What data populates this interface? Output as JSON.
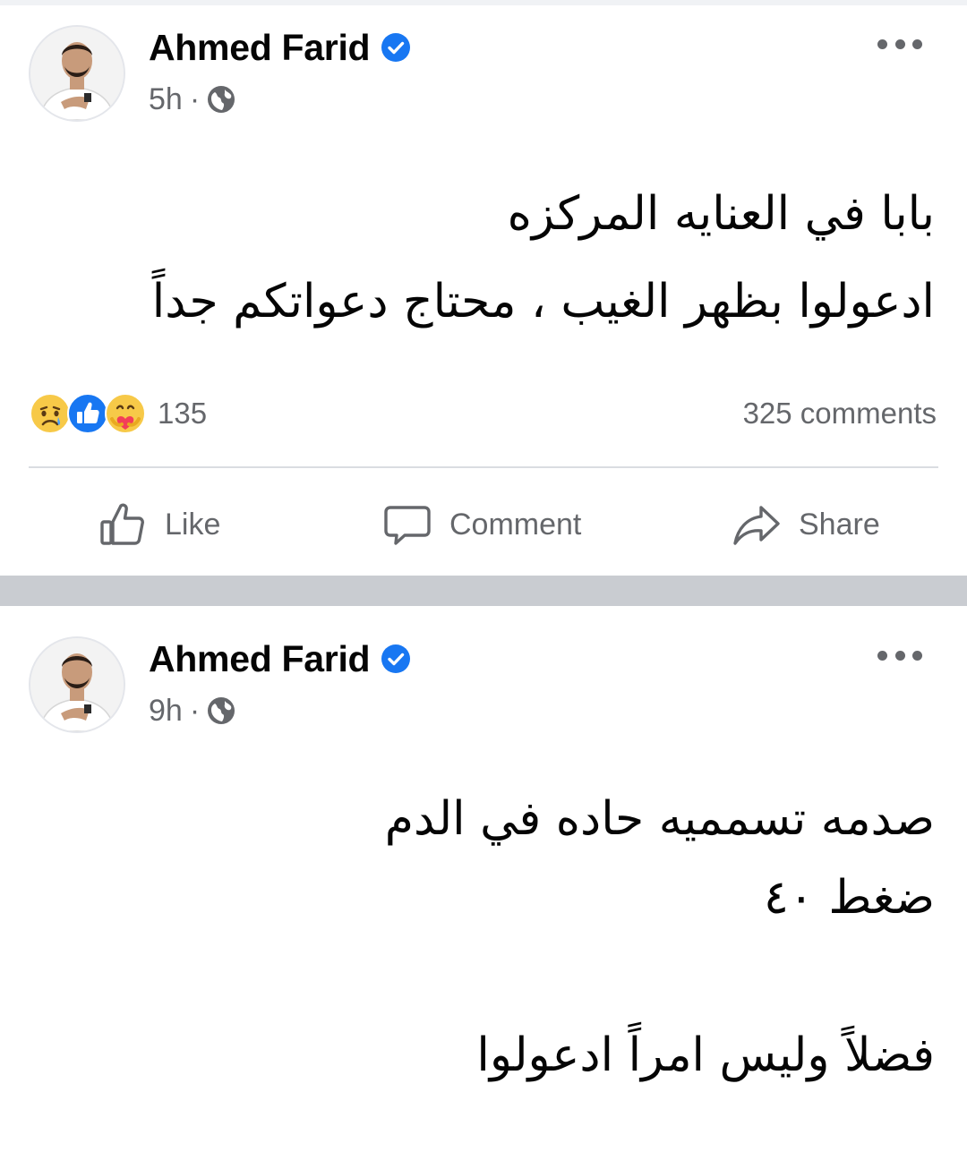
{
  "posts": [
    {
      "author": "Ahmed Farid",
      "time": "5h",
      "separator": "·",
      "icons": {
        "verified": "verified-badge-icon",
        "audience": "globe-icon",
        "more": "more-options-icon"
      },
      "text_lines": [
        "بابا في العنايه المركزه",
        "ادعولوا بظهر الغيب ، محتاج دعواتكم جداً"
      ],
      "reactions": {
        "types": [
          "sad-reaction-icon",
          "like-reaction-icon",
          "care-reaction-icon"
        ],
        "count": "135"
      },
      "comments": "325 comments",
      "actions": {
        "like": "Like",
        "comment": "Comment",
        "share": "Share"
      }
    },
    {
      "author": "Ahmed Farid",
      "time": "9h",
      "separator": "·",
      "icons": {
        "verified": "verified-badge-icon",
        "audience": "globe-icon",
        "more": "more-options-icon"
      },
      "text_lines": [
        "صدمه تسممیه حاده في الدم",
        "ضغط ٤٠",
        "",
        "فضلاً وليس امراً ادعولوا"
      ]
    }
  ],
  "colors": {
    "verified": "#1877f2",
    "secondary_text": "#65676b",
    "divider_band": "#c9ccd1",
    "primary_text": "#050505"
  }
}
